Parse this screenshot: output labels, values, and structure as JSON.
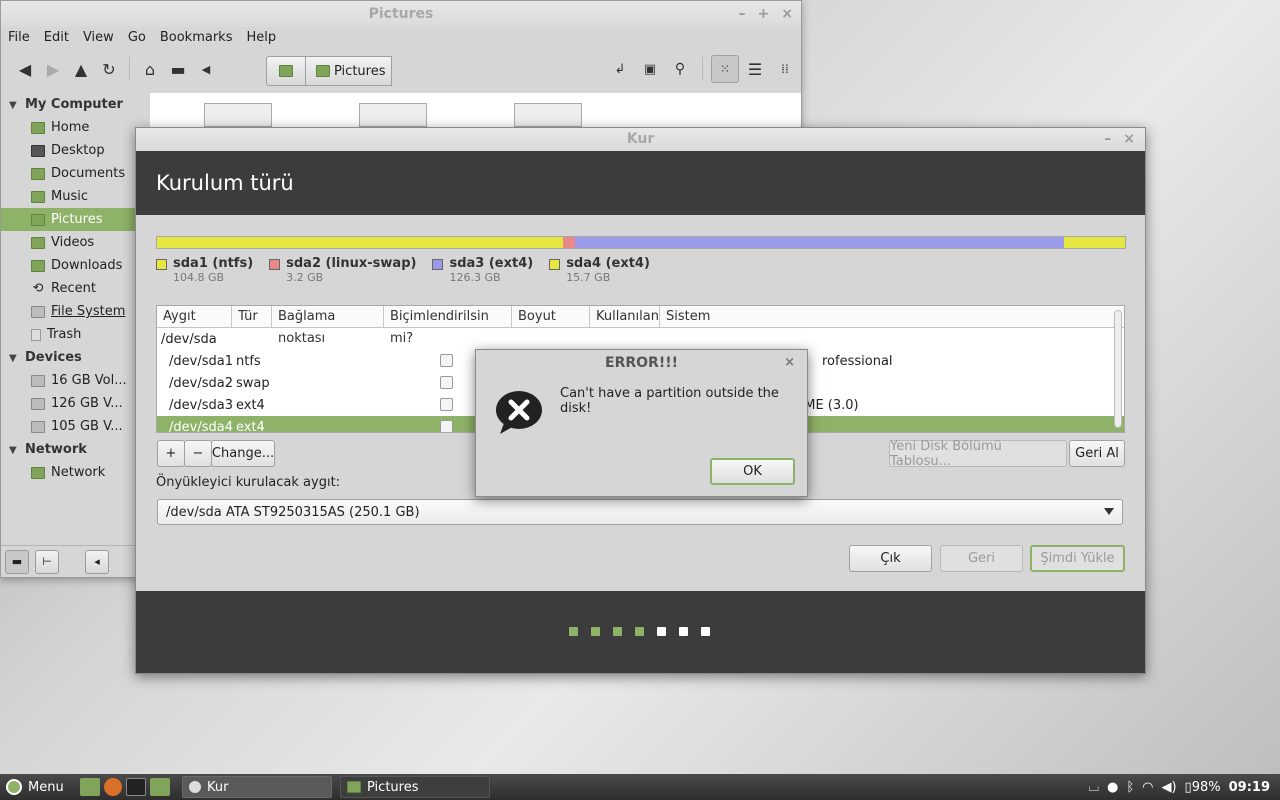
{
  "file_manager": {
    "title": "Pictures",
    "window_buttons": [
      "–",
      "+",
      "×"
    ],
    "menu": [
      "File",
      "Edit",
      "View",
      "Go",
      "Bookmarks",
      "Help"
    ],
    "pathbar": {
      "current": "Pictures"
    },
    "sidebar": {
      "sections": [
        {
          "title": "My Computer",
          "items": [
            "Home",
            "Desktop",
            "Documents",
            "Music",
            "Pictures",
            "Videos",
            "Downloads",
            "Recent",
            "File System",
            "Trash"
          ]
        },
        {
          "title": "Devices",
          "items": [
            "16 GB Vol...",
            "126 GB V...",
            "105 GB V..."
          ]
        },
        {
          "title": "Network",
          "items": [
            "Network"
          ]
        }
      ],
      "active": "Pictures"
    }
  },
  "installer": {
    "title": "Kur",
    "window_buttons": [
      "–",
      "×"
    ],
    "header": "Kurulum türü",
    "disk_bar": {
      "segments": [
        {
          "name": "sda1 (ntfs)",
          "size": "104.8 GB",
          "gb": 104.8,
          "color": "#e6e640"
        },
        {
          "name": "sda2 (linux-swap)",
          "size": "3.2 GB",
          "gb": 3.2,
          "color": "#e88a8a"
        },
        {
          "name": "sda3 (ext4)",
          "size": "126.3 GB",
          "gb": 126.3,
          "color": "#9a9ae8"
        },
        {
          "name": "sda4 (ext4)",
          "size": "15.7 GB",
          "gb": 15.7,
          "color": "#e6e640"
        }
      ]
    },
    "table": {
      "columns": [
        "Aygıt",
        "Tür",
        "Bağlama noktası",
        "Biçimlendirilsin mi?",
        "Boyut",
        "Kullanılan",
        "Sistem"
      ],
      "disk": "/dev/sda",
      "rows": [
        {
          "device": "/dev/sda1",
          "type": "ntfs",
          "system": "rofessional"
        },
        {
          "device": "/dev/sda2",
          "type": "swap",
          "system": ""
        },
        {
          "device": "/dev/sda3",
          "type": "ext4",
          "system": "OME (3.0)"
        },
        {
          "device": "/dev/sda4",
          "type": "ext4",
          "system": ""
        }
      ],
      "selected_row": 3
    },
    "buttons": {
      "add": "+",
      "remove": "−",
      "change": "Change...",
      "new_table": "Yeni Disk Bölümü Tablosu...",
      "revert": "Geri Al",
      "quit": "Çık",
      "back": "Geri",
      "install_now": "Şimdi Yükle"
    },
    "bootloader_label": "Önyükleyici kurulacak aygıt:",
    "bootloader_device": "/dev/sda   ATA ST9250315AS (250.1 GB)",
    "progress": {
      "total_steps": 7,
      "completed_steps": 4
    }
  },
  "error_dialog": {
    "title": "ERROR!!!",
    "close": "×",
    "message": "Can't have a partition outside the disk!",
    "ok": "OK"
  },
  "taskbar": {
    "menu_label": "Menu",
    "tasks": [
      "Kur",
      "Pictures"
    ],
    "battery": "98%",
    "clock": "09:19"
  },
  "colors": {
    "accent": "#8fb269",
    "header_bg": "#3c3c3c"
  }
}
